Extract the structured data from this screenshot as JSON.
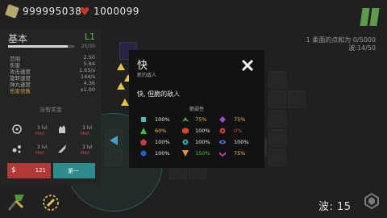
{
  "top": {
    "gold": "999995038",
    "lives": "1000099"
  },
  "info": {
    "line1": "1 柔面的点和为 0/5000",
    "line2": "波:14/50"
  },
  "panel": {
    "title": "基本",
    "level": "L1",
    "xp": "25/30",
    "stats": [
      {
        "label": "范围",
        "value": "2.50"
      },
      {
        "label": "伤害",
        "value": "5.84"
      },
      {
        "label": "攻击速度",
        "value": "1.65/s"
      },
      {
        "label": "旋转速度",
        "value": "144/s"
      },
      {
        "label": "弹丸速度",
        "value": "4.36"
      },
      {
        "label": "伤害倍数",
        "value": "x1.00"
      }
    ],
    "no_reward": "没有奖金",
    "abilities": [
      {
        "lvl": "3 lvl",
        "max": "MAX"
      },
      {
        "lvl": "3 lvl",
        "max": "MAX"
      },
      {
        "lvl": "3 lvl",
        "max": "MAX"
      },
      {
        "lvl": "3 lvl",
        "max": "MAX"
      }
    ],
    "sell_value": "121",
    "upgrade_label": "第一"
  },
  "wave": "波: 15",
  "popup": {
    "title": "快",
    "subtitle": "新的敌人",
    "description": "快, 但脆的敌人",
    "resist_header": "脆弱性",
    "resist": [
      {
        "icon": "square-teal",
        "color": "#3fbfbf",
        "value": "100%",
        "vcolor": "#e8e8e8"
      },
      {
        "icon": "chevron-green",
        "color": "#4aa84a",
        "value": "75%",
        "vcolor": "#e6c24a"
      },
      {
        "icon": "diamond-purple",
        "color": "#a04ad0",
        "value": "75%",
        "vcolor": "#e6c24a"
      },
      {
        "icon": "triangle-green",
        "color": "#3fbf3f",
        "value": "60%",
        "vcolor": "#e6c24a"
      },
      {
        "icon": "hexagon-red",
        "color": "#d04a2a",
        "value": "100%",
        "vcolor": "#e8e8e8"
      },
      {
        "icon": "gear-red",
        "color": "#c83a3a",
        "value": "0%",
        "vcolor": "#d04a4a"
      },
      {
        "icon": "pentagon-red",
        "color": "#d03a3a",
        "value": "100%",
        "vcolor": "#e8e8e8"
      },
      {
        "icon": "gear-teal",
        "color": "#2fa0a0",
        "value": "100%",
        "vcolor": "#e8e8e8"
      },
      {
        "icon": "eye-blue",
        "color": "#3a6ad0",
        "value": "100%",
        "vcolor": "#e8e8e8"
      },
      {
        "icon": "circle-blue",
        "color": "#2a5ad0",
        "value": "100%",
        "vcolor": "#e8e8e8"
      },
      {
        "icon": "triangle-down-orange",
        "color": "#e09a2a",
        "value": "150%",
        "vcolor": "#4ac84a"
      },
      {
        "icon": "arrow-magenta",
        "color": "#c83aa0",
        "value": "75%",
        "vcolor": "#e6c24a"
      }
    ]
  }
}
